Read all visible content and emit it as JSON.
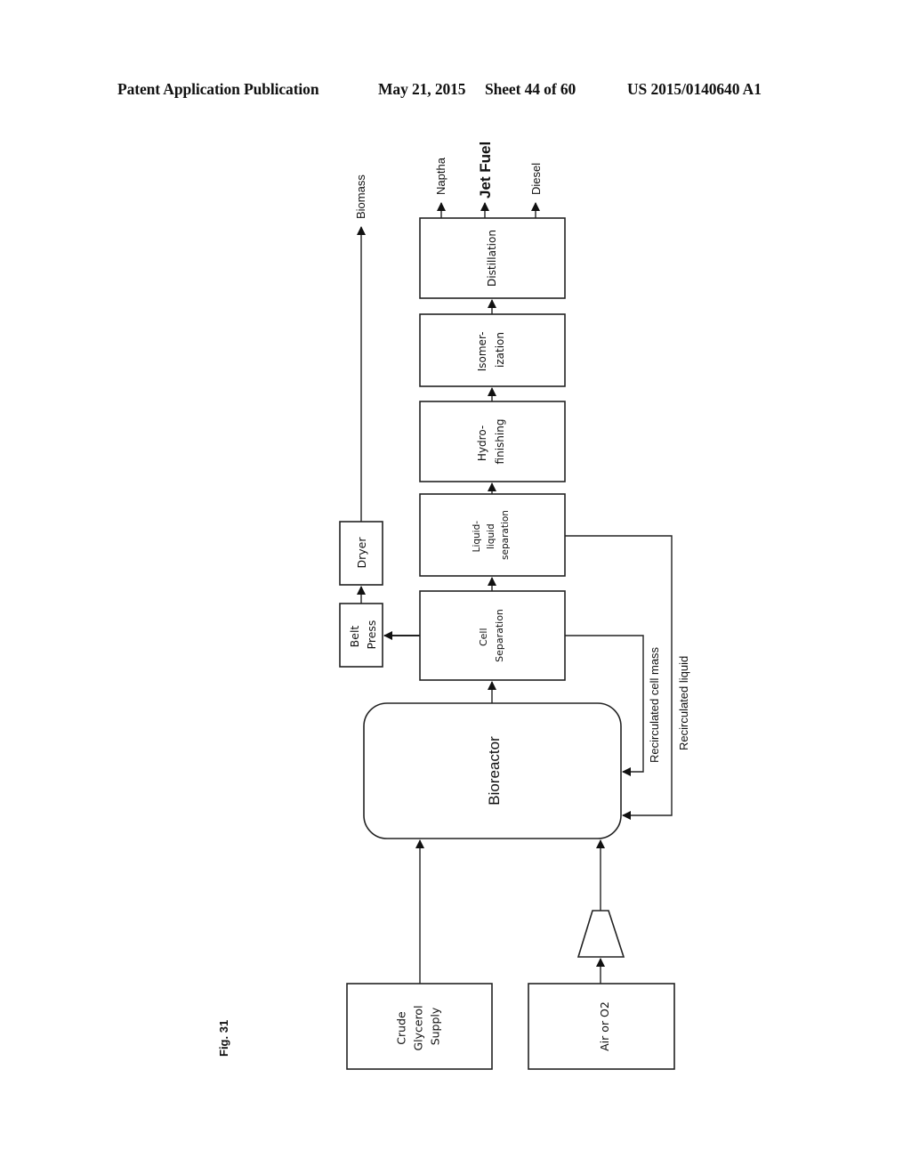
{
  "header": {
    "publication": "Patent Application Publication",
    "date": "May 21, 2015",
    "sheet": "Sheet 44 of 60",
    "number": "US 2015/0140640 A1"
  },
  "figure": {
    "label": "Fig. 31",
    "nodes": {
      "glycerol": [
        "Crude",
        "Glycerol",
        "Supply"
      ],
      "air": [
        "Air or O2"
      ],
      "compressor": "compressor",
      "bioreactor": [
        "Bioreactor"
      ],
      "cell_separation": [
        "Cell",
        "Separation"
      ],
      "liquid_separation": [
        "Liquid-",
        "liquid",
        "separation"
      ],
      "hydrofinishing": [
        "Hydro-",
        "finishing"
      ],
      "isomerization": [
        "Isomer-",
        "ization"
      ],
      "distillation": [
        "Distillation"
      ],
      "belt_press": [
        "Belt",
        "Press"
      ],
      "dryer": [
        "Dryer"
      ]
    },
    "outputs": {
      "biomass": "Biomass",
      "naptha": "Naptha",
      "jet_fuel": "Jet Fuel",
      "diesel": "Diesel"
    },
    "streams": {
      "recirculated_cell_mass": "Recirculated cell mass",
      "recirculated_liquid": "Recirculated liquid"
    }
  }
}
